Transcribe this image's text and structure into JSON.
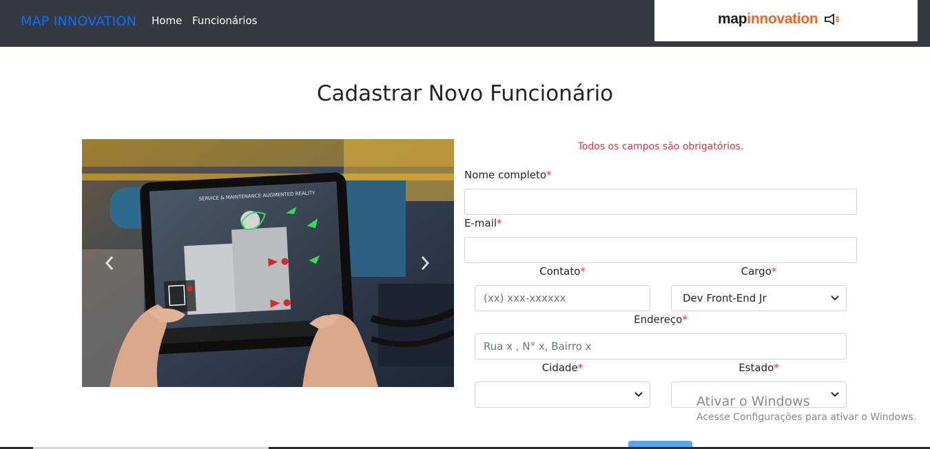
{
  "navbar": {
    "brand": "MAP INNOVATION",
    "links": [
      "Home",
      "Funcionários"
    ],
    "logo": {
      "part1": "map",
      "part2": "innovation"
    }
  },
  "page": {
    "title": "Cadastrar Novo Funcionário"
  },
  "carousel": {
    "prev_icon": "chevron-left-icon",
    "next_icon": "chevron-right-icon",
    "slide_caption": "SERVICE & MAINTENANCE  AUGMENTED REALITY"
  },
  "form": {
    "required_note": "Todos os campos são obrigatórios.",
    "required_marker": "*",
    "nome": {
      "label": "Nome completo",
      "value": "",
      "placeholder": ""
    },
    "email": {
      "label": "E-mail",
      "value": "",
      "placeholder": ""
    },
    "contato": {
      "label": "Contato",
      "placeholder": "(xx) xxx-xxxxxx"
    },
    "cargo": {
      "label": "Cargo",
      "selected": "Dev Front-End Jr"
    },
    "endereco": {
      "label": "Endereço",
      "placeholder": "Rua x , N° x, Bairro x"
    },
    "cidade": {
      "label": "Cidade",
      "selected": ""
    },
    "estado": {
      "label": "Estado",
      "selected": ""
    }
  },
  "watermark": {
    "title": "Ativar o Windows",
    "subtitle": "Acesse Configurações para ativar o Windows."
  },
  "colors": {
    "navbar_bg": "#343a40",
    "brand": "#0d6efd",
    "required": "#dc3545",
    "logo_accent": "#e8672a",
    "submit": "#5aa4f0"
  }
}
